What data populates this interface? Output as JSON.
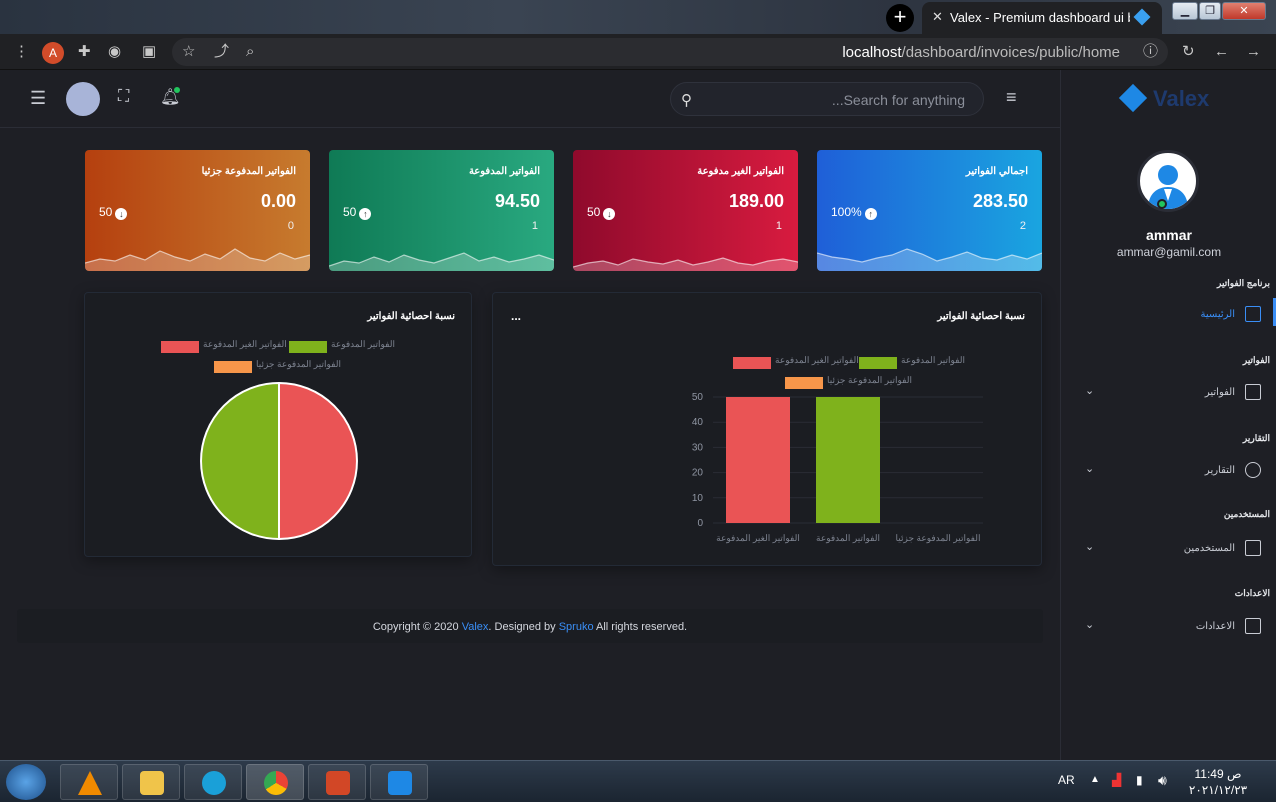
{
  "browser": {
    "new_tab_label": "+",
    "tab_title": "Valex - Premium dashboard ui bo",
    "tab_close": "✕",
    "url_host": "localhost",
    "url_path": "/dashboard/invoices/public/home",
    "profile_initial": "A"
  },
  "header": {
    "search_placeholder": "...Search for anything"
  },
  "sidebar": {
    "logo_text": "Valex",
    "user_name": "ammar",
    "user_email": "ammar@gamil.com",
    "sections": [
      {
        "title": "برنامج الفواتير",
        "item": "الرئيسية",
        "icon": "grid-icon"
      },
      {
        "title": "الفواتير",
        "item": "الفواتير",
        "icon": "bar-chart-icon"
      },
      {
        "title": "التقارير",
        "item": "التقارير",
        "icon": "pie-chart-icon"
      },
      {
        "title": "المستخدمين",
        "item": "المستخدمين",
        "icon": "chat-icon"
      },
      {
        "title": "الاعدادات",
        "item": "الاعدادات",
        "icon": "book-icon"
      }
    ]
  },
  "cards": [
    {
      "title": "اجمالي الفواتير",
      "amount": "283.50",
      "count": "2",
      "percent": "100%",
      "direction": "up",
      "color_from": "#1f5fd8",
      "color_to": "#1aa5e0",
      "wave": [
        18,
        14,
        12,
        9,
        13,
        16,
        22,
        17,
        10,
        14,
        19,
        13,
        11,
        16,
        12,
        18
      ]
    },
    {
      "title": "الفواتير الغير مدفوعة",
      "amount": "189.00",
      "count": "1",
      "percent": "50",
      "direction": "down",
      "color_from": "#8f0a2c",
      "color_to": "#d81b3f",
      "wave": [
        4,
        8,
        10,
        6,
        12,
        9,
        7,
        11,
        6,
        9,
        13,
        8,
        6,
        10,
        12,
        9
      ]
    },
    {
      "title": "الفواتير المدفوعة",
      "amount": "94.50",
      "count": "1",
      "percent": "50",
      "direction": "up",
      "color_from": "#0f7a55",
      "color_to": "#29a980",
      "wave": [
        5,
        10,
        8,
        14,
        9,
        16,
        11,
        8,
        13,
        18,
        10,
        14,
        9,
        12,
        16,
        11
      ]
    },
    {
      "title": "الفواتير المدفوعة جزئيا",
      "amount": "0.00",
      "count": "0",
      "percent": "50",
      "direction": "down",
      "color_from": "#b5400f",
      "color_to": "#c77b2e",
      "wave": [
        8,
        12,
        10,
        16,
        11,
        20,
        14,
        10,
        17,
        12,
        22,
        13,
        10,
        18,
        12,
        16
      ]
    }
  ],
  "bar_panel": {
    "title": "نسبة احصائية الفواتير",
    "menu": "..."
  },
  "pie_panel": {
    "title": "نسبة احصائية الفواتير"
  },
  "footer": {
    "prefix": "Copyright © 2020 ",
    "brand": "Valex",
    "middle": ". Designed by ",
    "designer": "Spruko",
    "suffix": " All rights reserved."
  },
  "taskbar": {
    "lang": "AR",
    "time": "ص 11:49",
    "date": "٢٠٢١/١٢/٢٣"
  },
  "chart_data": [
    {
      "type": "bar",
      "categories": [
        "الفواتير الغير المدفوعة",
        "الفواتير المدفوعة",
        "الفواتير المدفوعة جزئيا"
      ],
      "series": [
        {
          "name": "الفواتير الغير المدفوعة",
          "values": [
            50,
            0,
            0
          ],
          "color": "#ea5455"
        },
        {
          "name": "الفواتير المدفوعة",
          "values": [
            0,
            50,
            0
          ],
          "color": "#7fb21c"
        },
        {
          "name": "الفواتير المدفوعة جزئيا",
          "values": [
            0,
            0,
            0
          ],
          "color": "#f7964a"
        }
      ],
      "ylim": [
        0,
        50
      ],
      "yticks": [
        0,
        10,
        20,
        30,
        40,
        50
      ]
    },
    {
      "type": "pie",
      "labels": [
        "الفواتير الغير المدفوعة",
        "الفواتير المدفوعة",
        "الفواتير المدفوعة جزئيا"
      ],
      "values": [
        50,
        50,
        0
      ],
      "colors": [
        "#ea5455",
        "#7fb21c",
        "#f7964a"
      ]
    }
  ]
}
